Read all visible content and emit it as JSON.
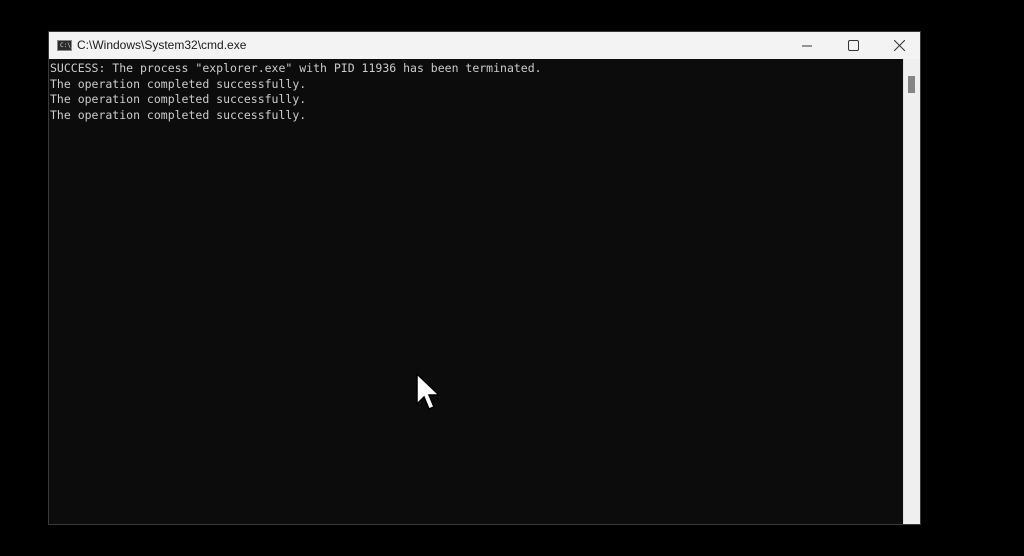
{
  "window": {
    "title": "C:\\Windows\\System32\\cmd.exe",
    "icon": "cmd-icon",
    "icon_text": "C:\\_",
    "controls": {
      "minimize": "minimize-icon",
      "maximize": "maximize-icon",
      "close": "close-icon"
    }
  },
  "console": {
    "lines": [
      "SUCCESS: The process \"explorer.exe\" with PID 11936 has been terminated.",
      "The operation completed successfully.",
      "The operation completed successfully.",
      "The operation completed successfully."
    ]
  },
  "colors": {
    "console_bg": "#0c0c0c",
    "console_text": "#cccccc",
    "titlebar_bg": "#f3f3f3"
  }
}
